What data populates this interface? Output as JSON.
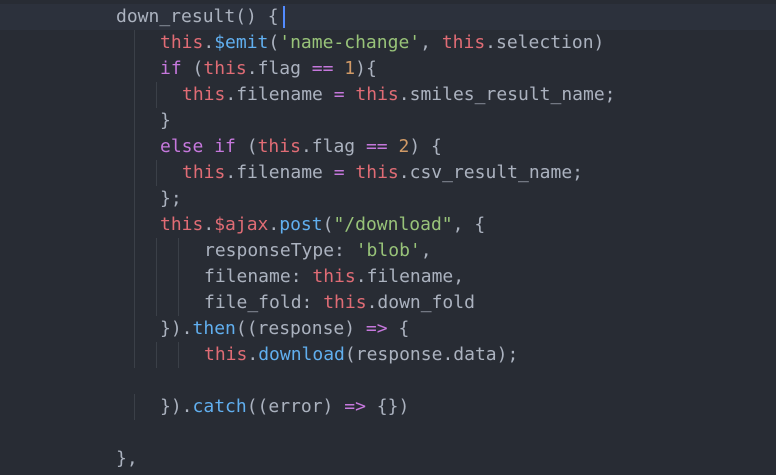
{
  "editor": {
    "lines": [
      [
        {
          "t": "down_result",
          "c": "fn-plain"
        },
        {
          "t": "() {",
          "c": "plain"
        }
      ],
      [
        {
          "t": "this",
          "c": "this"
        },
        {
          "t": ".",
          "c": "plain"
        },
        {
          "t": "$emit",
          "c": "fn"
        },
        {
          "t": "(",
          "c": "plain"
        },
        {
          "t": "'name-change'",
          "c": "str"
        },
        {
          "t": ", ",
          "c": "plain"
        },
        {
          "t": "this",
          "c": "this"
        },
        {
          "t": ".selection)",
          "c": "plain"
        }
      ],
      [
        {
          "t": "if",
          "c": "kw"
        },
        {
          "t": " (",
          "c": "plain"
        },
        {
          "t": "this",
          "c": "this"
        },
        {
          "t": ".flag ",
          "c": "plain"
        },
        {
          "t": "==",
          "c": "kw"
        },
        {
          "t": " ",
          "c": "plain"
        },
        {
          "t": "1",
          "c": "num"
        },
        {
          "t": "){",
          "c": "plain"
        }
      ],
      [
        {
          "t": "this",
          "c": "this"
        },
        {
          "t": ".filename ",
          "c": "plain"
        },
        {
          "t": "=",
          "c": "kw"
        },
        {
          "t": " ",
          "c": "plain"
        },
        {
          "t": "this",
          "c": "this"
        },
        {
          "t": ".smiles_result_name;",
          "c": "plain"
        }
      ],
      [
        {
          "t": "}",
          "c": "plain"
        }
      ],
      [
        {
          "t": "else",
          "c": "kw"
        },
        {
          "t": " ",
          "c": "plain"
        },
        {
          "t": "if",
          "c": "kw"
        },
        {
          "t": " (",
          "c": "plain"
        },
        {
          "t": "this",
          "c": "this"
        },
        {
          "t": ".flag ",
          "c": "plain"
        },
        {
          "t": "==",
          "c": "kw"
        },
        {
          "t": " ",
          "c": "plain"
        },
        {
          "t": "2",
          "c": "num"
        },
        {
          "t": ") {",
          "c": "plain"
        }
      ],
      [
        {
          "t": "this",
          "c": "this"
        },
        {
          "t": ".filename ",
          "c": "plain"
        },
        {
          "t": "=",
          "c": "kw"
        },
        {
          "t": " ",
          "c": "plain"
        },
        {
          "t": "this",
          "c": "this"
        },
        {
          "t": ".csv_result_name;",
          "c": "plain"
        }
      ],
      [
        {
          "t": "};",
          "c": "plain"
        }
      ],
      [
        {
          "t": "this",
          "c": "this"
        },
        {
          "t": ".",
          "c": "plain"
        },
        {
          "t": "$ajax",
          "c": "this"
        },
        {
          "t": ".",
          "c": "plain"
        },
        {
          "t": "post",
          "c": "fn"
        },
        {
          "t": "(",
          "c": "plain"
        },
        {
          "t": "\"/download\"",
          "c": "str"
        },
        {
          "t": ", {",
          "c": "plain"
        }
      ],
      [
        {
          "t": "responseType: ",
          "c": "plain"
        },
        {
          "t": "'blob'",
          "c": "str"
        },
        {
          "t": ",",
          "c": "plain"
        }
      ],
      [
        {
          "t": "filename: ",
          "c": "plain"
        },
        {
          "t": "this",
          "c": "this"
        },
        {
          "t": ".filename,",
          "c": "plain"
        }
      ],
      [
        {
          "t": "file_fold: ",
          "c": "plain"
        },
        {
          "t": "this",
          "c": "this"
        },
        {
          "t": ".down_fold",
          "c": "plain"
        }
      ],
      [
        {
          "t": "}).",
          "c": "plain"
        },
        {
          "t": "then",
          "c": "fn"
        },
        {
          "t": "((response) ",
          "c": "plain"
        },
        {
          "t": "=>",
          "c": "kw"
        },
        {
          "t": " {",
          "c": "plain"
        }
      ],
      [
        {
          "t": "this",
          "c": "this"
        },
        {
          "t": ".",
          "c": "plain"
        },
        {
          "t": "download",
          "c": "fn"
        },
        {
          "t": "(response.data);",
          "c": "plain"
        }
      ],
      [],
      [
        {
          "t": "}).",
          "c": "plain"
        },
        {
          "t": "catch",
          "c": "fn"
        },
        {
          "t": "((error) ",
          "c": "plain"
        },
        {
          "t": "=>",
          "c": "kw"
        },
        {
          "t": " {})",
          "c": "plain"
        }
      ],
      [],
      [
        {
          "t": "},",
          "c": "plain"
        }
      ]
    ],
    "indents": [
      0,
      2,
      2,
      3,
      2,
      2,
      3,
      2,
      2,
      4,
      4,
      4,
      2,
      4,
      0,
      2,
      0,
      0
    ],
    "caret_line": 0,
    "colors": {
      "background": "#282c34",
      "keyword": "#c678dd",
      "this": "#e06c75",
      "function": "#61afef",
      "string": "#98c379",
      "number": "#d19a66",
      "plain": "#abb2bf",
      "caret": "#528bff"
    }
  }
}
